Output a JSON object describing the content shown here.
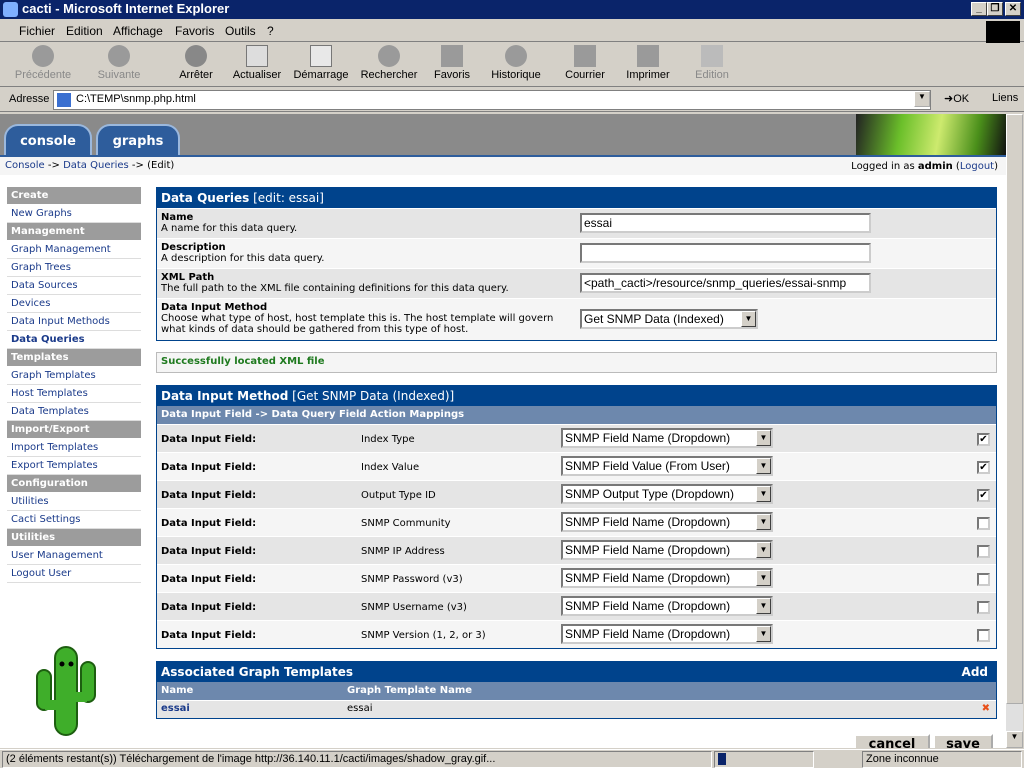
{
  "window": {
    "title": "cacti - Microsoft Internet Explorer"
  },
  "menu": [
    "Fichier",
    "Edition",
    "Affichage",
    "Favoris",
    "Outils",
    "?"
  ],
  "toolbar": [
    {
      "label": "Précédente",
      "icon": "back-arrow-icon",
      "disabled": true
    },
    {
      "label": "Suivante",
      "icon": "forward-arrow-icon",
      "disabled": true
    },
    {
      "label": "Arrêter",
      "icon": "stop-icon"
    },
    {
      "label": "Actualiser",
      "icon": "refresh-icon"
    },
    {
      "label": "Démarrage",
      "icon": "home-icon"
    },
    {
      "label": "Rechercher",
      "icon": "search-icon"
    },
    {
      "label": "Favoris",
      "icon": "favorites-icon"
    },
    {
      "label": "Historique",
      "icon": "history-icon"
    },
    {
      "label": "Courrier",
      "icon": "mail-icon"
    },
    {
      "label": "Imprimer",
      "icon": "print-icon"
    },
    {
      "label": "Edition",
      "icon": "edit-icon",
      "disabled": true
    }
  ],
  "address": {
    "label": "Adresse",
    "value": "C:\\TEMP\\snmp.php.html",
    "go": "OK",
    "links": "Liens"
  },
  "tabs": [
    "console",
    "graphs"
  ],
  "breadcrumb": {
    "console": "Console",
    "sep1": " -> ",
    "queries": "Data Queries",
    "sep2": " -> ",
    "edit": "(Edit)"
  },
  "login": {
    "prefix": "Logged in as ",
    "user": "admin",
    "logout": "Logout"
  },
  "sidebar": [
    {
      "label": "Create",
      "header": true
    },
    {
      "label": "New Graphs"
    },
    {
      "label": "Management",
      "header": true
    },
    {
      "label": "Graph Management"
    },
    {
      "label": "Graph Trees"
    },
    {
      "label": "Data Sources"
    },
    {
      "label": "Devices"
    },
    {
      "label": "Data Input Methods"
    },
    {
      "label": "Data Queries",
      "active": true
    },
    {
      "label": "Templates",
      "header": true
    },
    {
      "label": "Graph Templates"
    },
    {
      "label": "Host Templates"
    },
    {
      "label": "Data Templates"
    },
    {
      "label": "Import/Export",
      "header": true
    },
    {
      "label": "Import Templates"
    },
    {
      "label": "Export Templates"
    },
    {
      "label": "Configuration",
      "header": true
    },
    {
      "label": "Utilities"
    },
    {
      "label": "Cacti Settings"
    },
    {
      "label": "Utilities",
      "header": true
    },
    {
      "label": "User Management"
    },
    {
      "label": "Logout User"
    }
  ],
  "query_panel": {
    "title": "Data Queries",
    "subtitle": "[edit: essai]",
    "fields": [
      {
        "label": "Name",
        "desc": "A name for this data query.",
        "value": "essai"
      },
      {
        "label": "Description",
        "desc": "A description for this data query.",
        "value": ""
      },
      {
        "label": "XML Path",
        "desc": "The full path to the XML file containing definitions for this data query.",
        "value": "<path_cacti>/resource/snmp_queries/essai-snmp"
      },
      {
        "label": "Data Input Method",
        "desc": "Choose what type of host, host template this is. The host template will govern what kinds of data should be gathered from this type of host.",
        "value": "Get SNMP Data (Indexed)"
      }
    ]
  },
  "success_message": "Successfully located XML file",
  "input_panel": {
    "title": "Data Input Method",
    "subtitle": "[Get SNMP Data (Indexed)]",
    "subheader": "Data Input Field -> Data Query Field Action Mappings",
    "rows": [
      {
        "label": "Data Input Field:",
        "field": "Index Type",
        "value": "SNMP Field Name (Dropdown)",
        "checked": true
      },
      {
        "label": "Data Input Field:",
        "field": "Index Value",
        "value": "SNMP Field Value (From User)",
        "checked": true
      },
      {
        "label": "Data Input Field:",
        "field": "Output Type ID",
        "value": "SNMP Output Type (Dropdown)",
        "checked": true
      },
      {
        "label": "Data Input Field:",
        "field": "SNMP Community",
        "value": "SNMP Field Name (Dropdown)",
        "checked": false
      },
      {
        "label": "Data Input Field:",
        "field": "SNMP IP Address",
        "value": "SNMP Field Name (Dropdown)",
        "checked": false
      },
      {
        "label": "Data Input Field:",
        "field": "SNMP Password (v3)",
        "value": "SNMP Field Name (Dropdown)",
        "checked": false
      },
      {
        "label": "Data Input Field:",
        "field": "SNMP Username (v3)",
        "value": "SNMP Field Name (Dropdown)",
        "checked": false
      },
      {
        "label": "Data Input Field:",
        "field": "SNMP Version (1, 2, or 3)",
        "value": "SNMP Field Name (Dropdown)",
        "checked": false
      }
    ]
  },
  "graph_panel": {
    "title": "Associated Graph Templates",
    "add": "Add",
    "col_name": "Name",
    "col_template": "Graph Template Name",
    "rows": [
      {
        "name": "essai",
        "template": "essai"
      }
    ]
  },
  "buttons": {
    "cancel": "cancel",
    "save": "save"
  },
  "status": {
    "text": "(2 éléments restant(s)) Téléchargement de l'image http://36.140.11.1/cacti/images/shadow_gray.gif...",
    "zone": "Zone inconnue"
  },
  "colors": {
    "header": "#00438c",
    "subheader": "#6d88ad",
    "success": "#1f7a1f",
    "delete": "#e8501a"
  }
}
